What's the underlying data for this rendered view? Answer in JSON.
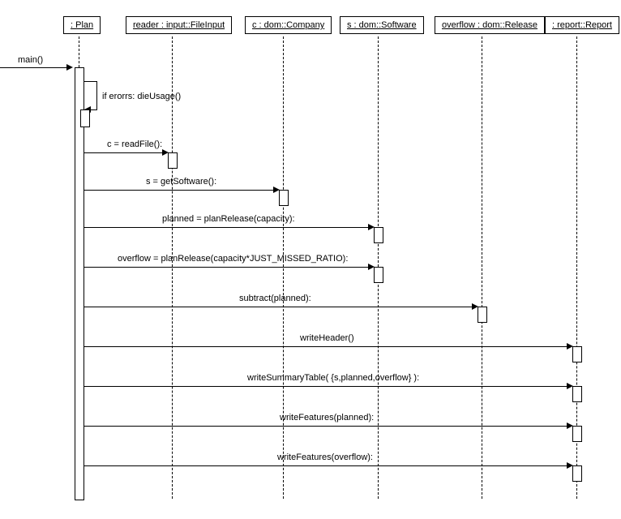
{
  "diagram_type": "sequence",
  "participants": {
    "p1": ": Plan",
    "p2": "reader : input::FileInput",
    "p3": "c : dom::Company",
    "p4": "s : dom::Software",
    "p5": "overflow : dom::Release",
    "p6": ": report::Report"
  },
  "entry": "main()",
  "messages": {
    "m1": "if erorrs: dieUsage()",
    "m2": "c = readFile():",
    "m3": "s = getSoftware():",
    "m4": "planned = planRelease(capacity):",
    "m5": "overflow = planRelease(capacity*JUST_MISSED_RATIO):",
    "m6": "subtract(planned):",
    "m7": "writeHeader()",
    "m8": "writeSummaryTable( {s,planned,overflow} ):",
    "m9": "writeFeatures(planned):",
    "m10": "writeFeatures(overflow):"
  },
  "chart_data": {
    "type": "sequence-diagram",
    "participants": [
      {
        "id": "p1",
        "label": ": Plan"
      },
      {
        "id": "p2",
        "label": "reader : input::FileInput"
      },
      {
        "id": "p3",
        "label": "c : dom::Company"
      },
      {
        "id": "p4",
        "label": "s : dom::Software"
      },
      {
        "id": "p5",
        "label": "overflow : dom::Release"
      },
      {
        "id": "p6",
        "label": ": report::Report"
      }
    ],
    "initiator": {
      "into": "p1",
      "label": "main()"
    },
    "interactions": [
      {
        "from": "p1",
        "to": "p1",
        "label": "if erorrs: dieUsage()",
        "self": true
      },
      {
        "from": "p1",
        "to": "p2",
        "label": "c = readFile():"
      },
      {
        "from": "p1",
        "to": "p3",
        "label": "s = getSoftware():"
      },
      {
        "from": "p1",
        "to": "p4",
        "label": "planned = planRelease(capacity):"
      },
      {
        "from": "p1",
        "to": "p4",
        "label": "overflow = planRelease(capacity*JUST_MISSED_RATIO):"
      },
      {
        "from": "p1",
        "to": "p5",
        "label": "subtract(planned):"
      },
      {
        "from": "p1",
        "to": "p6",
        "label": "writeHeader()"
      },
      {
        "from": "p1",
        "to": "p6",
        "label": "writeSummaryTable( {s,planned,overflow} ):"
      },
      {
        "from": "p1",
        "to": "p6",
        "label": "writeFeatures(planned):"
      },
      {
        "from": "p1",
        "to": "p6",
        "label": "writeFeatures(overflow):"
      }
    ]
  }
}
